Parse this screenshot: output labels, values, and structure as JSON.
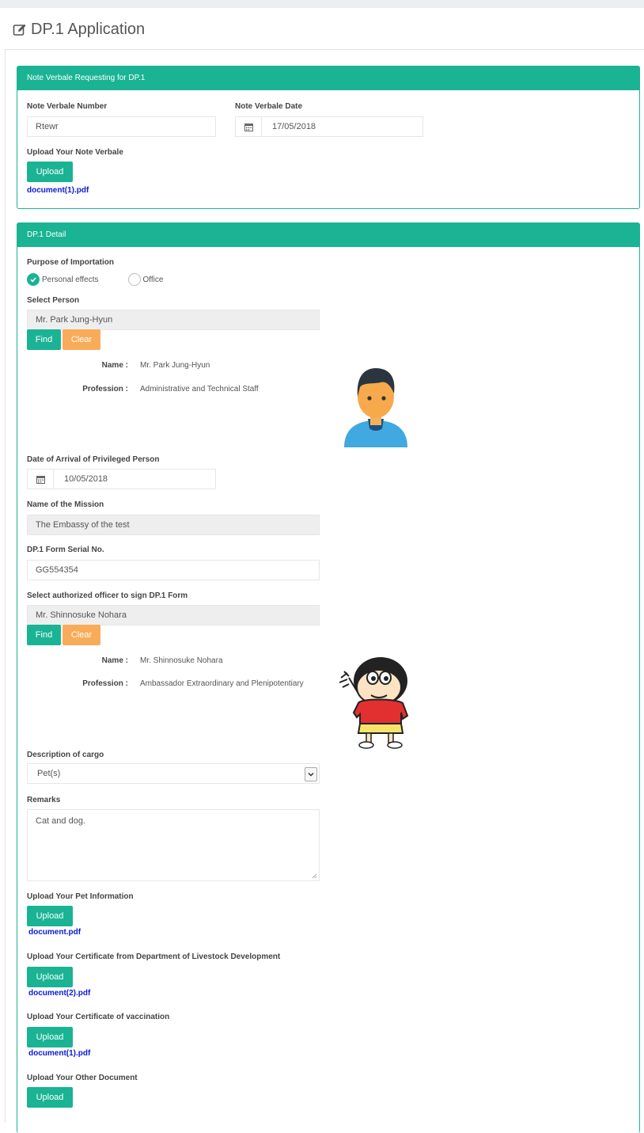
{
  "page": {
    "title": "DP.1 Application"
  },
  "note_verbale": {
    "header": "Note Verbale Requesting for DP.1",
    "number_label": "Note Verbale Number",
    "number_value": "Rtewr",
    "date_label": "Note Verbale Date",
    "date_value": "17/05/2018",
    "upload_label": "Upload Your Note Verbale",
    "upload_button": "Upload",
    "file": "document(1).pdf"
  },
  "detail": {
    "header": "DP.1 Detail",
    "purpose_label": "Purpose of Importation",
    "purpose_options": [
      "Personal effects",
      "Office"
    ],
    "purpose_selected": "Personal effects",
    "select_person_label": "Select Person",
    "person_value": "Mr. Park Jung-Hyun",
    "find_button": "Find",
    "clear_button": "Clear",
    "person": {
      "name_key": "Name :",
      "name": "Mr. Park Jung-Hyun",
      "profession_key": "Profession :",
      "profession": "Administrative and Technical Staff"
    },
    "arrival_label": "Date of Arrival of Privileged Person",
    "arrival_value": "10/05/2018",
    "mission_label": "Name of the Mission",
    "mission_value": "The Embassy of the test",
    "serial_label": "DP.1 Form Serial No.",
    "serial_value": "GG554354",
    "officer_label": "Select authorized officer to sign DP.1 Form",
    "officer_value": "Mr. Shinnosuke Nohara",
    "officer": {
      "name_key": "Name :",
      "name": "Mr. Shinnosuke Nohara",
      "profession_key": "Profession :",
      "profession": "Ambassador Extraordinary and Plenipotentiary"
    },
    "cargo_label": "Description of cargo",
    "cargo_value": "Pet(s)",
    "remarks_label": "Remarks",
    "remarks_value": "Cat and dog.",
    "uploads": [
      {
        "label": "Upload Your Pet Information",
        "button": "Upload",
        "file": "document.pdf"
      },
      {
        "label": "Upload Your Certificate from Department of Livestock Development",
        "button": "Upload",
        "file": "document(2).pdf"
      },
      {
        "label": "Upload Your Certificate of vaccination",
        "button": "Upload",
        "file": "document(1).pdf"
      },
      {
        "label": "Upload Your Other Document",
        "button": "Upload",
        "file": ""
      }
    ]
  },
  "colors": {
    "primary": "#1ab394",
    "warning": "#f8ac59",
    "link": "#0a1ad8"
  }
}
